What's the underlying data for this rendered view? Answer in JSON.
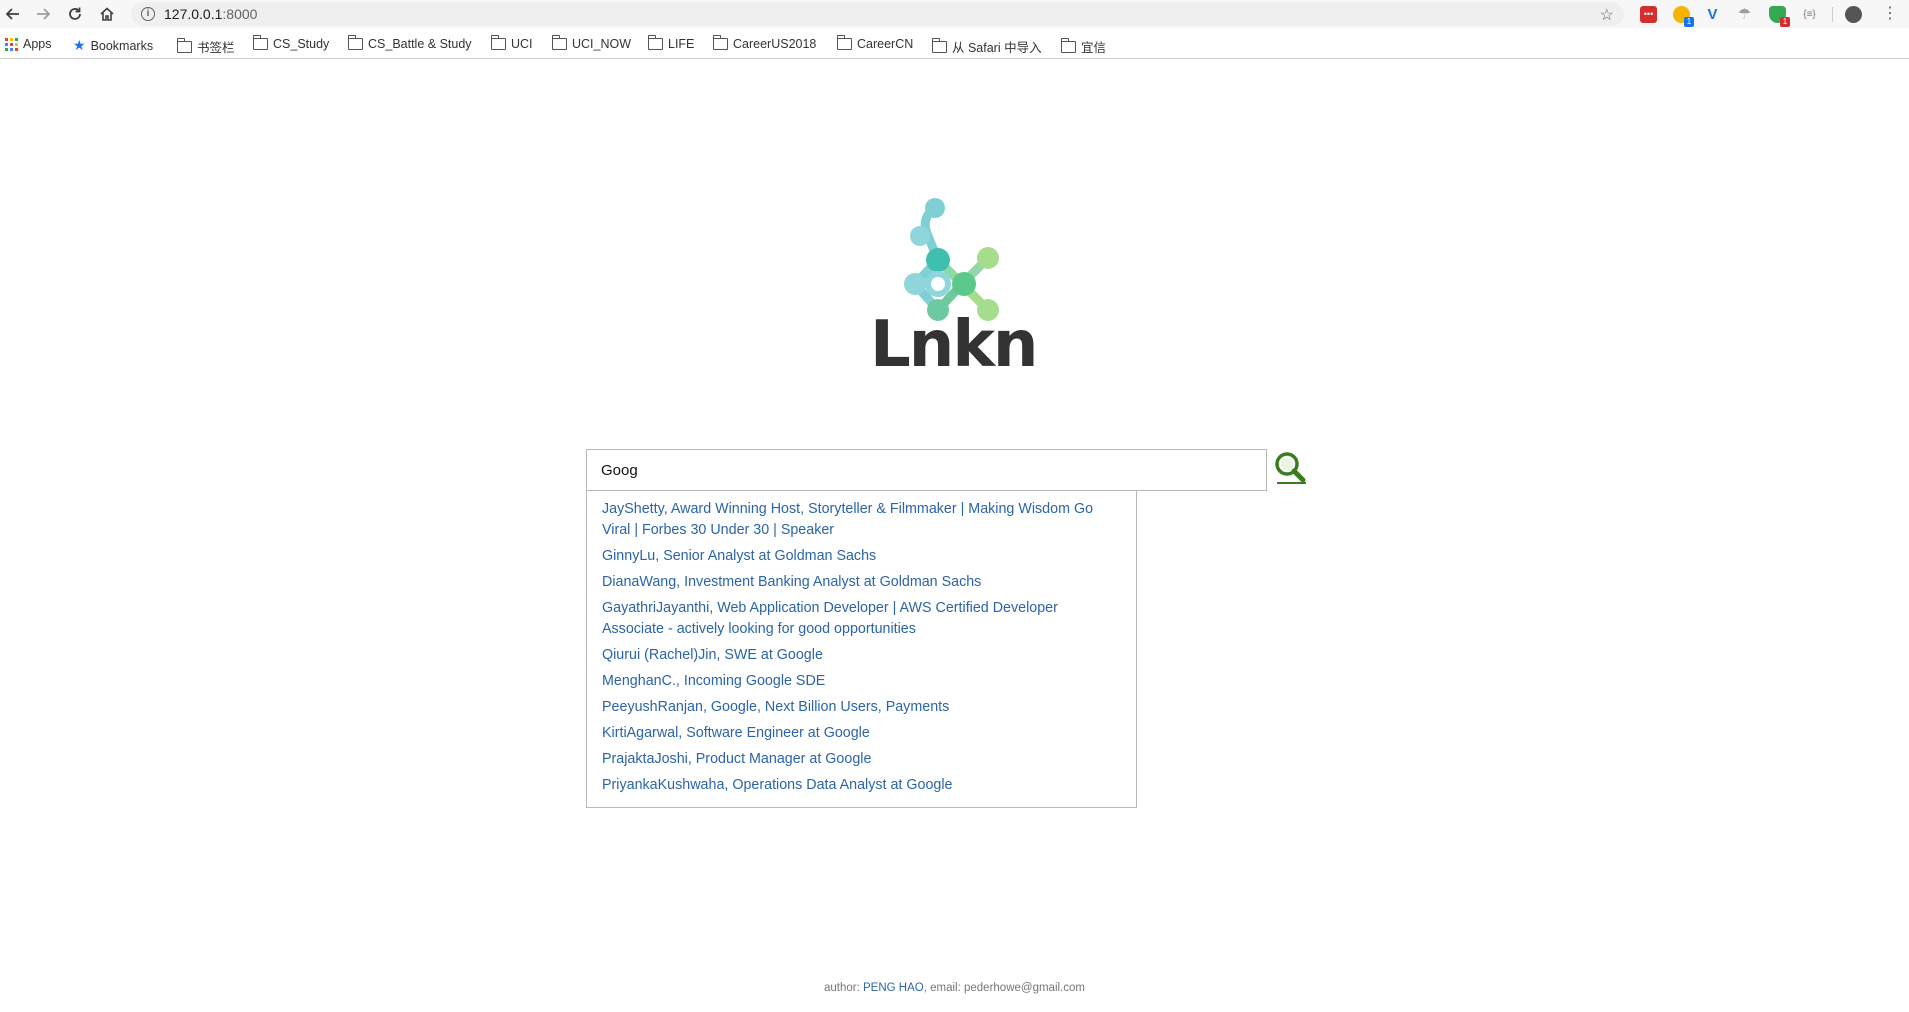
{
  "browser": {
    "url_host": "127.0.0.1",
    "url_port": ":8000",
    "extensions": [
      {
        "name": "lastpass-ext",
        "color": "#d32f2f"
      },
      {
        "name": "chat-ext",
        "color": "#f4b400",
        "badge": "1",
        "badge_color": "#1a73e8"
      },
      {
        "name": "vue-devtools-ext",
        "color": "#1a73e8"
      },
      {
        "name": "parachute-ext",
        "color": "#9e9e9e"
      },
      {
        "name": "shield-ext",
        "color": "#34a853",
        "badge": "1",
        "badge_color": "#d32f2f"
      },
      {
        "name": "json-ext",
        "color": "#9e9e9e"
      }
    ]
  },
  "bookmarks": {
    "apps": "Apps",
    "bookmarks": "Bookmarks",
    "folders": [
      "书签栏",
      "CS_Study",
      "CS_Battle & Study",
      "UCI",
      "UCI_NOW",
      "LIFE",
      "CareerUS2018",
      "CareerCN",
      "从 Safari 中导入",
      "宜信"
    ]
  },
  "page": {
    "logo_text": "Lnkn",
    "search": {
      "value": "Goog",
      "placeholder": ""
    },
    "suggestions": [
      "JayShetty, Award Winning Host, Storyteller & Filmmaker | Making Wisdom Go Viral | Forbes 30 Under 30 | Speaker",
      "GinnyLu, Senior Analyst at Goldman Sachs",
      "DianaWang, Investment Banking Analyst at Goldman Sachs",
      "GayathriJayanthi, Web Application Developer | AWS Certified Developer Associate - actively looking for good opportunities",
      "Qiurui (Rachel)Jin, SWE at Google",
      "MenghanC., Incoming Google SDE",
      "PeeyushRanjan, Google, Next Billion Users, Payments",
      "KirtiAgarwal, Software Engineer at Google",
      "PrajaktaJoshi, Product Manager at Google",
      "PriyankaKushwaha, Operations Data Analyst at Google"
    ],
    "footer": {
      "author_label": "author: ",
      "author_name": "PENG HAO",
      "email_label": ", email: pederhowe@gmail.com"
    }
  },
  "colors": {
    "link": "#2b64a8",
    "search_icon": "#3a7d1e"
  }
}
